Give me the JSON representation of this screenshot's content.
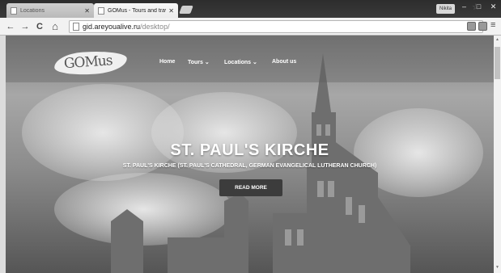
{
  "browser": {
    "tabs": [
      {
        "title": "Locations",
        "active": false
      },
      {
        "title": "GOMus - Tours and travel",
        "active": true
      }
    ],
    "profile_label": "Nikita",
    "window_controls": {
      "minimize": "–",
      "maximize": "□",
      "close": "✕"
    },
    "address": {
      "host": "gid.areyoualive.ru",
      "path": "/desktop/"
    },
    "nav_icons": {
      "back": "←",
      "forward": "→",
      "reload": "C",
      "home": "⌂"
    },
    "star_icon": "☆",
    "menu_icon": "≡"
  },
  "site": {
    "logo_text": "GOMus",
    "nav": [
      {
        "label": "Home"
      },
      {
        "label": "Tours ⌄"
      },
      {
        "label": "Locations ⌄"
      },
      {
        "label": "About us"
      }
    ],
    "hero": {
      "title": "ST. PAUL'S KIRCHE",
      "subtitle": "ST. PAUL'S KIRCHE (ST. PAUL'S CATHEDRAL, GERMAN EVANGELICAL LUTHERAN CHURCH)",
      "button_label": "READ MORE"
    }
  }
}
